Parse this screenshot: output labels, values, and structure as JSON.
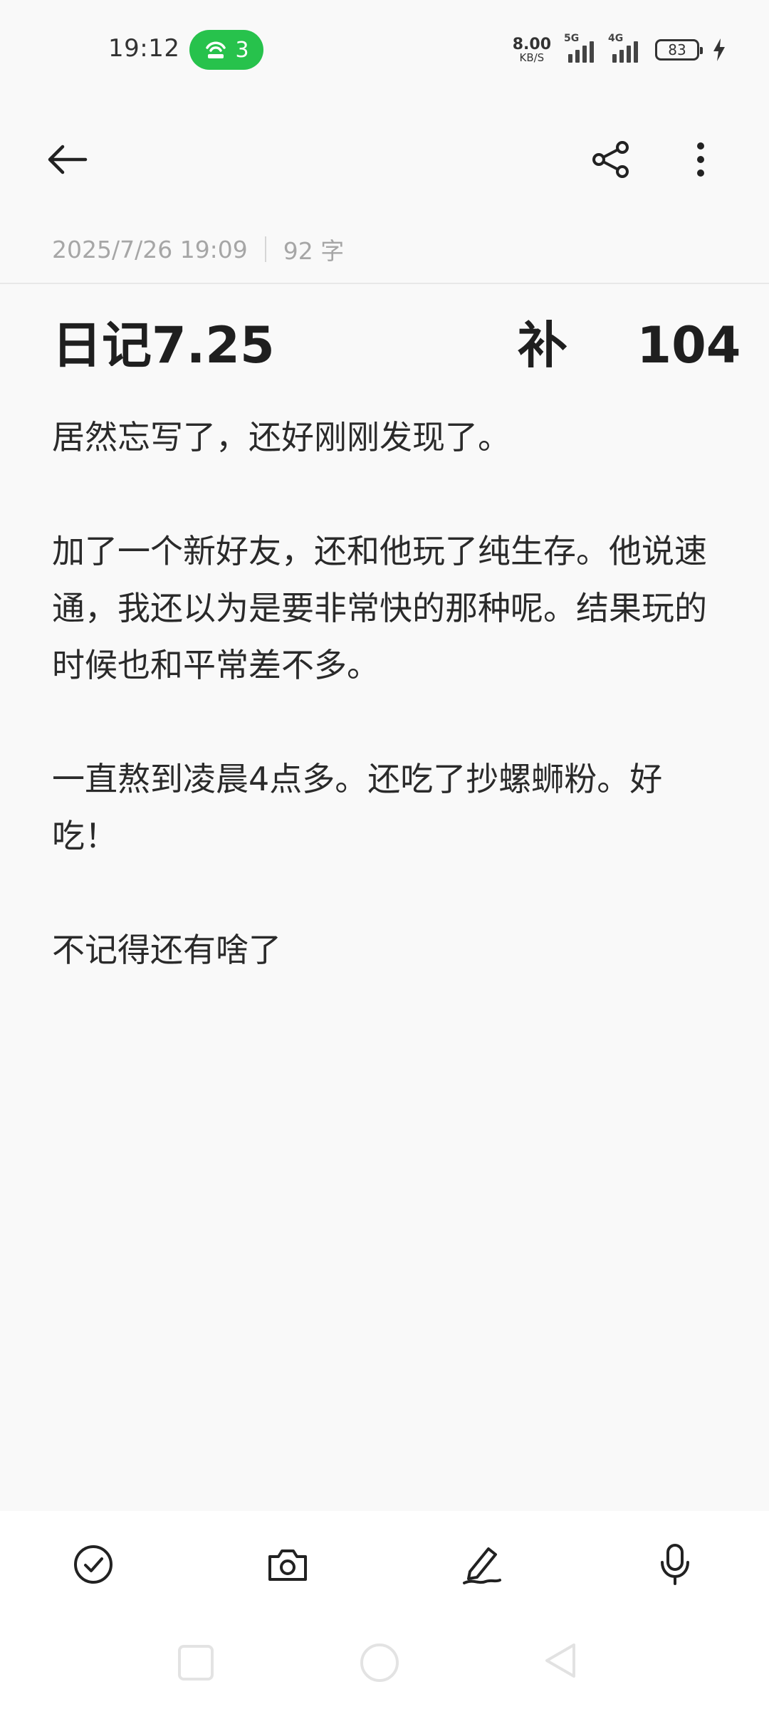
{
  "status_bar": {
    "time": "19:12",
    "hotspot_count": "3",
    "net_speed_value": "8.00",
    "net_speed_unit": "KB/S",
    "sim1_tag": "5G",
    "sim2_tag": "4G",
    "battery": "83"
  },
  "meta": {
    "datetime": "2025/7/26 19:09",
    "word_count": "92 字"
  },
  "note": {
    "title": "日记7.25              补    104",
    "paragraphs": [
      "居然忘写了，还好刚刚发现了。",
      "加了一个新好友，还和他玩了纯生存。他说速通，我还以为是要非常快的那种呢。结果玩的时候也和平常差不多。",
      "一直熬到凌晨4点多。还吃了抄螺蛳粉。好吃！",
      "不记得还有啥了"
    ]
  },
  "colors": {
    "hotspot_green": "#27c24c",
    "background": "#f9f9f9",
    "meta_gray": "#a6a6a6"
  },
  "icons": {
    "back": "arrow-left-icon",
    "share": "share-icon",
    "more": "more-vertical-icon",
    "checklist": "check-circle-icon",
    "camera": "camera-icon",
    "handwrite": "pen-icon",
    "voice": "microphone-icon"
  }
}
